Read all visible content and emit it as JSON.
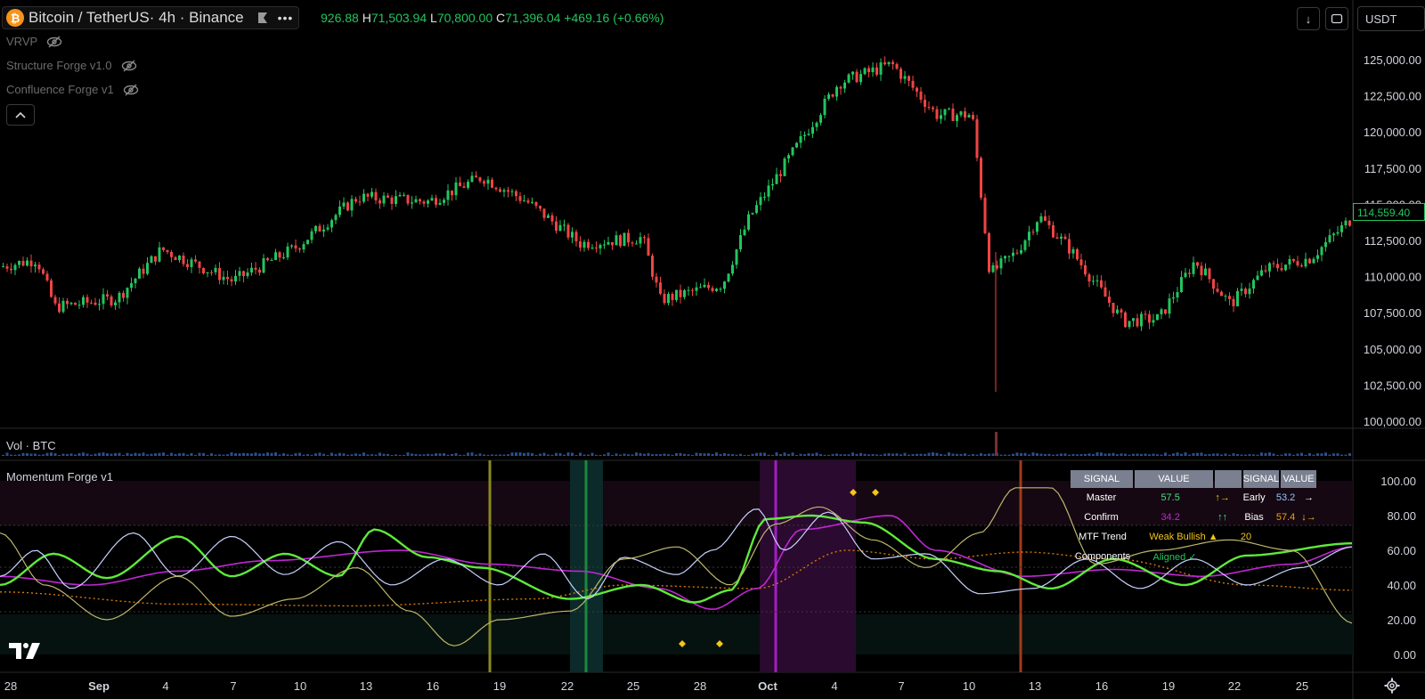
{
  "header": {
    "symbol": "Bitcoin / TetherUS",
    "interval": "· 4h · Binance",
    "logo_letter": "₿",
    "more_icon": "•••",
    "ohlc": {
      "o": "926.88",
      "h_label": "H",
      "h": "71,503.94",
      "l_label": "L",
      "l": "70,800.00",
      "c_label": "C",
      "c": "71,396.04",
      "change": "+469.16 (+0.66%)"
    },
    "currency": "USDT",
    "download_icon": "↓"
  },
  "indicators": [
    {
      "label": "VRVP"
    },
    {
      "label": "Structure Forge v1.0"
    },
    {
      "label": "Confluence Forge v1"
    }
  ],
  "volume_pane": {
    "title": "Vol · BTC"
  },
  "momentum_pane": {
    "title": "Momentum Forge v1"
  },
  "price_axis": [
    "125,000.00",
    "122,500.00",
    "120,000.00",
    "117,500.00",
    "115,000.00",
    "112,500.00",
    "110,000.00",
    "107,500.00",
    "105,000.00",
    "102,500.00",
    "100,000.00"
  ],
  "last_price": "114,559.40",
  "osc_axis": [
    "100.00",
    "80.00",
    "60.00",
    "40.00",
    "20.00",
    "0.00"
  ],
  "time_axis": [
    "28",
    "Sep",
    "4",
    "7",
    "10",
    "13",
    "16",
    "19",
    "22",
    "25",
    "28",
    "Oct",
    "4",
    "7",
    "10",
    "13",
    "16",
    "19",
    "22",
    "25"
  ],
  "signal_table": {
    "headers": [
      "SIGNAL",
      "VALUE",
      "",
      "SIGNAL",
      "VALUE"
    ],
    "rows": [
      {
        "c1": "Master",
        "c2": "57.5",
        "c3": "↑→",
        "c4": "Early",
        "c5": "53.2",
        "c6": "→"
      },
      {
        "c1": "Confirm",
        "c2": "34.2",
        "c3": "↑↑",
        "c4": "Bias",
        "c5": "57.4",
        "c6": "↓→"
      },
      {
        "c1": "MTF Trend",
        "c2": "Weak Bullish ▲",
        "c3": "",
        "c4": "20",
        "c5": "",
        "c6": ""
      },
      {
        "c1": "Components",
        "c2": "Aligned ✓",
        "c3": "",
        "c4": "",
        "c5": "",
        "c6": ""
      }
    ]
  },
  "colors": {
    "up": "#22c55e",
    "down": "#ef4444",
    "accent_yellow": "#f5c518",
    "magenta": "#c026d3",
    "white_line": "#ffffff"
  }
}
